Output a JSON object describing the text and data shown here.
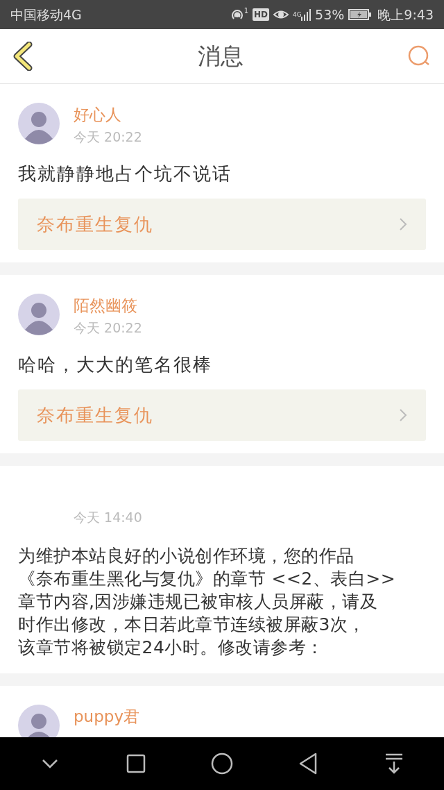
{
  "status_bar": {
    "carrier": "中国移动4G",
    "hotspot_count": "1",
    "hd_badge": "HD",
    "network_type": "4G",
    "battery_percent": "53%",
    "time": "晚上9:43"
  },
  "header": {
    "title": "消息"
  },
  "messages": [
    {
      "kind": "comment",
      "avatar": true,
      "name": "好心人",
      "time": "今天 20:22",
      "text": "我就静静地占个坑不说话",
      "link": {
        "title": "奈布重生复仇"
      }
    },
    {
      "kind": "comment",
      "avatar": true,
      "name": "陌然幽筱",
      "time": "今天 20:22",
      "text": "哈哈，大大的笔名很棒",
      "link": {
        "title": "奈布重生复仇"
      }
    },
    {
      "kind": "notice",
      "avatar": false,
      "time": "今天 14:40",
      "lines": [
        "为维护本站良好的小说创作环境，您的作品",
        "《奈布重生黑化与复仇》的章节 <<2、表白>>",
        "章节内容,因涉嫌违规已被审核人员屏蔽，请及",
        "时作出修改，本日若此章节连续被屏蔽3次，",
        "该章节将被锁定24小时。修改请参考："
      ]
    },
    {
      "kind": "comment",
      "avatar": true,
      "name": "puppy君"
    }
  ]
}
